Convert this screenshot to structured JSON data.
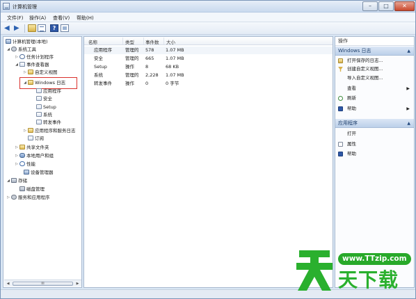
{
  "window": {
    "title": "计算机管理",
    "controls": {
      "minimize": "–",
      "maximize": "□",
      "close": "✕"
    }
  },
  "menu": [
    "文件(F)",
    "操作(A)",
    "查看(V)",
    "帮助(H)"
  ],
  "toolbar": {
    "back_icon": "back-arrow-icon",
    "forward_icon": "forward-arrow-icon",
    "help_glyph": "?"
  },
  "tree": {
    "root": "计算机管理(本地)",
    "system_tools": "系统工具",
    "task_scheduler": "任务计划程序",
    "event_viewer": "事件查看器",
    "custom_views": "自定义视图",
    "windows_logs": "Windows 日志",
    "log_application": "应用程序",
    "log_security": "安全",
    "log_setup": "Setup",
    "log_system": "系统",
    "log_forwarded": "转发事件",
    "app_service_logs": "应用程序和服务日志",
    "subscriptions": "订阅",
    "shared_folders": "共享文件夹",
    "local_users": "本地用户和组",
    "performance": "性能",
    "device_manager": "设备管理器",
    "storage": "存储",
    "disk_management": "磁盘管理",
    "services_apps": "服务和应用程序",
    "scroll_mid": "III"
  },
  "list": {
    "columns": [
      "名称",
      "类型",
      "事件数",
      "大小"
    ],
    "rows": [
      {
        "name": "应用程序",
        "type": "管理的",
        "count": "578",
        "size": "1.07 MB"
      },
      {
        "name": "安全",
        "type": "管理的",
        "count": "665",
        "size": "1.07 MB"
      },
      {
        "name": "Setup",
        "type": "操作",
        "count": "8",
        "size": "68 KB"
      },
      {
        "name": "系统",
        "type": "管理的",
        "count": "2,228",
        "size": "1.07 MB"
      },
      {
        "name": "转发事件",
        "type": "操作",
        "count": "0",
        "size": "0 字节"
      }
    ]
  },
  "actions": {
    "header": "操作",
    "section1": {
      "title": "Windows 日志",
      "items": {
        "open_saved": "打开保存的日志...",
        "create_view": "创建自定义视图...",
        "import_view": "导入自定义视图...",
        "view": "查看",
        "refresh": "刷新",
        "help": "帮助"
      }
    },
    "section2": {
      "title": "应用程序",
      "items": {
        "open": "打开",
        "properties": "属性",
        "help": "帮助"
      }
    },
    "caret": "▲",
    "submenu_arrow": "▶"
  },
  "watermark": {
    "url": "www.TTzip.com",
    "text": "天下载"
  },
  "colors": {
    "highlight_border": "#d9302b",
    "watermark_green": "#2ab02e"
  }
}
